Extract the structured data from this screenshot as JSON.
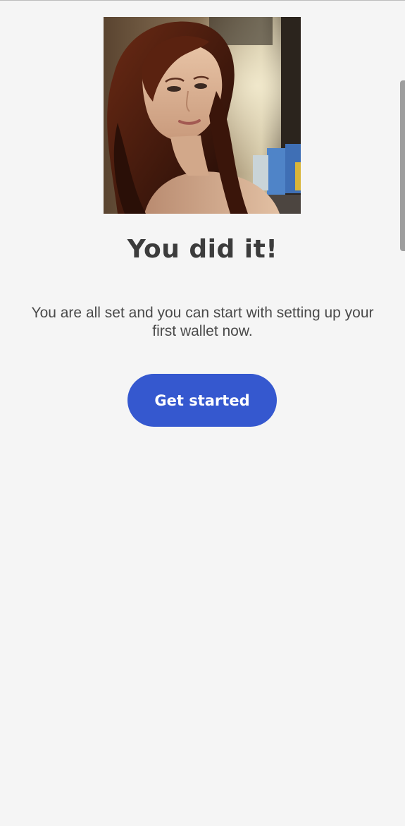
{
  "success": {
    "title": "You did it!",
    "message": "You are all set and you can start with setting up your first wallet now.",
    "button_label": "Get started"
  },
  "colors": {
    "background": "#f5f5f5",
    "title": "#3c3c3c",
    "message": "#4a4a4a",
    "button": "#3558cf",
    "button_text": "#ffffff"
  }
}
